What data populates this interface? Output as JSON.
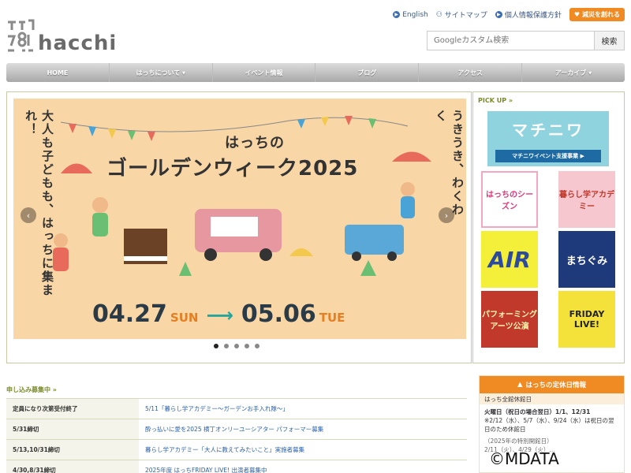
{
  "header": {
    "logo_text": "hacchi",
    "links": [
      {
        "label": "English"
      },
      {
        "label": "サイトマップ"
      },
      {
        "label": "個人情報保護方針"
      }
    ],
    "donate_label": "減災を創れる"
  },
  "search": {
    "placeholder": "Googleカスタム検索",
    "button_label": "検索"
  },
  "nav": [
    {
      "label": "HOME"
    },
    {
      "label": "はっちについて ▾"
    },
    {
      "label": "イベント情報"
    },
    {
      "label": "ブログ"
    },
    {
      "label": "アクセス"
    },
    {
      "label": "アーカイブ ▾"
    }
  ],
  "hero": {
    "title_small": "はっちの",
    "title_main": "ゴールデンウィーク2025",
    "left_vertical": "大人も子どもも、はっちに集まれ！",
    "right_vertical": "うきうき、わくわく",
    "start_date": "04.27",
    "start_dow": "SUN",
    "end_date": "05.06",
    "end_dow": "TUE",
    "slide_count": 5,
    "active_slide": 1
  },
  "pickup": {
    "title": "PICK UP »",
    "machi_title": "マチニワ",
    "machi_button": "マチニワイベント支援事業 ▶",
    "tiles": [
      {
        "label": "はっちのシーズン",
        "bg": "#ffffff",
        "fg": "#e0397a"
      },
      {
        "label": "暮らし学アカデミー",
        "bg": "#f6c7cf",
        "fg": "#c0392b"
      },
      {
        "label": "AIR",
        "bg": "#f4f03a",
        "fg": "#2b4aa0"
      },
      {
        "label": "まちぐみ",
        "bg": "#1f3a7a",
        "fg": "#ffffff"
      },
      {
        "label": "パフォーミングアーツ公演",
        "bg": "#c0392b",
        "fg": "#fff7b0"
      },
      {
        "label": "FRIDAY LIVE!",
        "bg": "#f4e23a",
        "fg": "#222222"
      }
    ]
  },
  "apply": {
    "title": "申し込み募集中 »",
    "rows": [
      {
        "deadline": "定員になり次第受付終了",
        "title": "5/11「暮らし学アカデミー〜ガーデンお手入れ隊〜」"
      },
      {
        "deadline": "5/31締切",
        "title": "酔っ払いに愛を2025 横丁オンリーユーシアター パフォーマー募集"
      },
      {
        "deadline": "5/13,10/31締切",
        "title": "暮らし学アカデミー「大人に教えてみたいこと」実施者募集"
      },
      {
        "deadline": "4/30,8/31締切",
        "title": "2025年度 はっちFRIDAY LIVE! 出演者募集中"
      }
    ]
  },
  "holiday": {
    "title": "はっちの定休日情報",
    "sub": "はっち全館休館日",
    "line1": "火曜日（祝日の場合翌日）1/1、12/31",
    "line2": "※2/12（水）、5/7（水）、9/24（水）は祝日の翌日のため休館日",
    "line3": "（2025年の特別開館日）",
    "line4": "2/11（火）、4/29（火）…"
  },
  "watermark": "©MDATA",
  "colors": {
    "accent_orange": "#f08a22",
    "link_blue": "#2a5fa8",
    "nav_gray": "#a9a9a9",
    "banner_bg": "#f8d6a6"
  }
}
